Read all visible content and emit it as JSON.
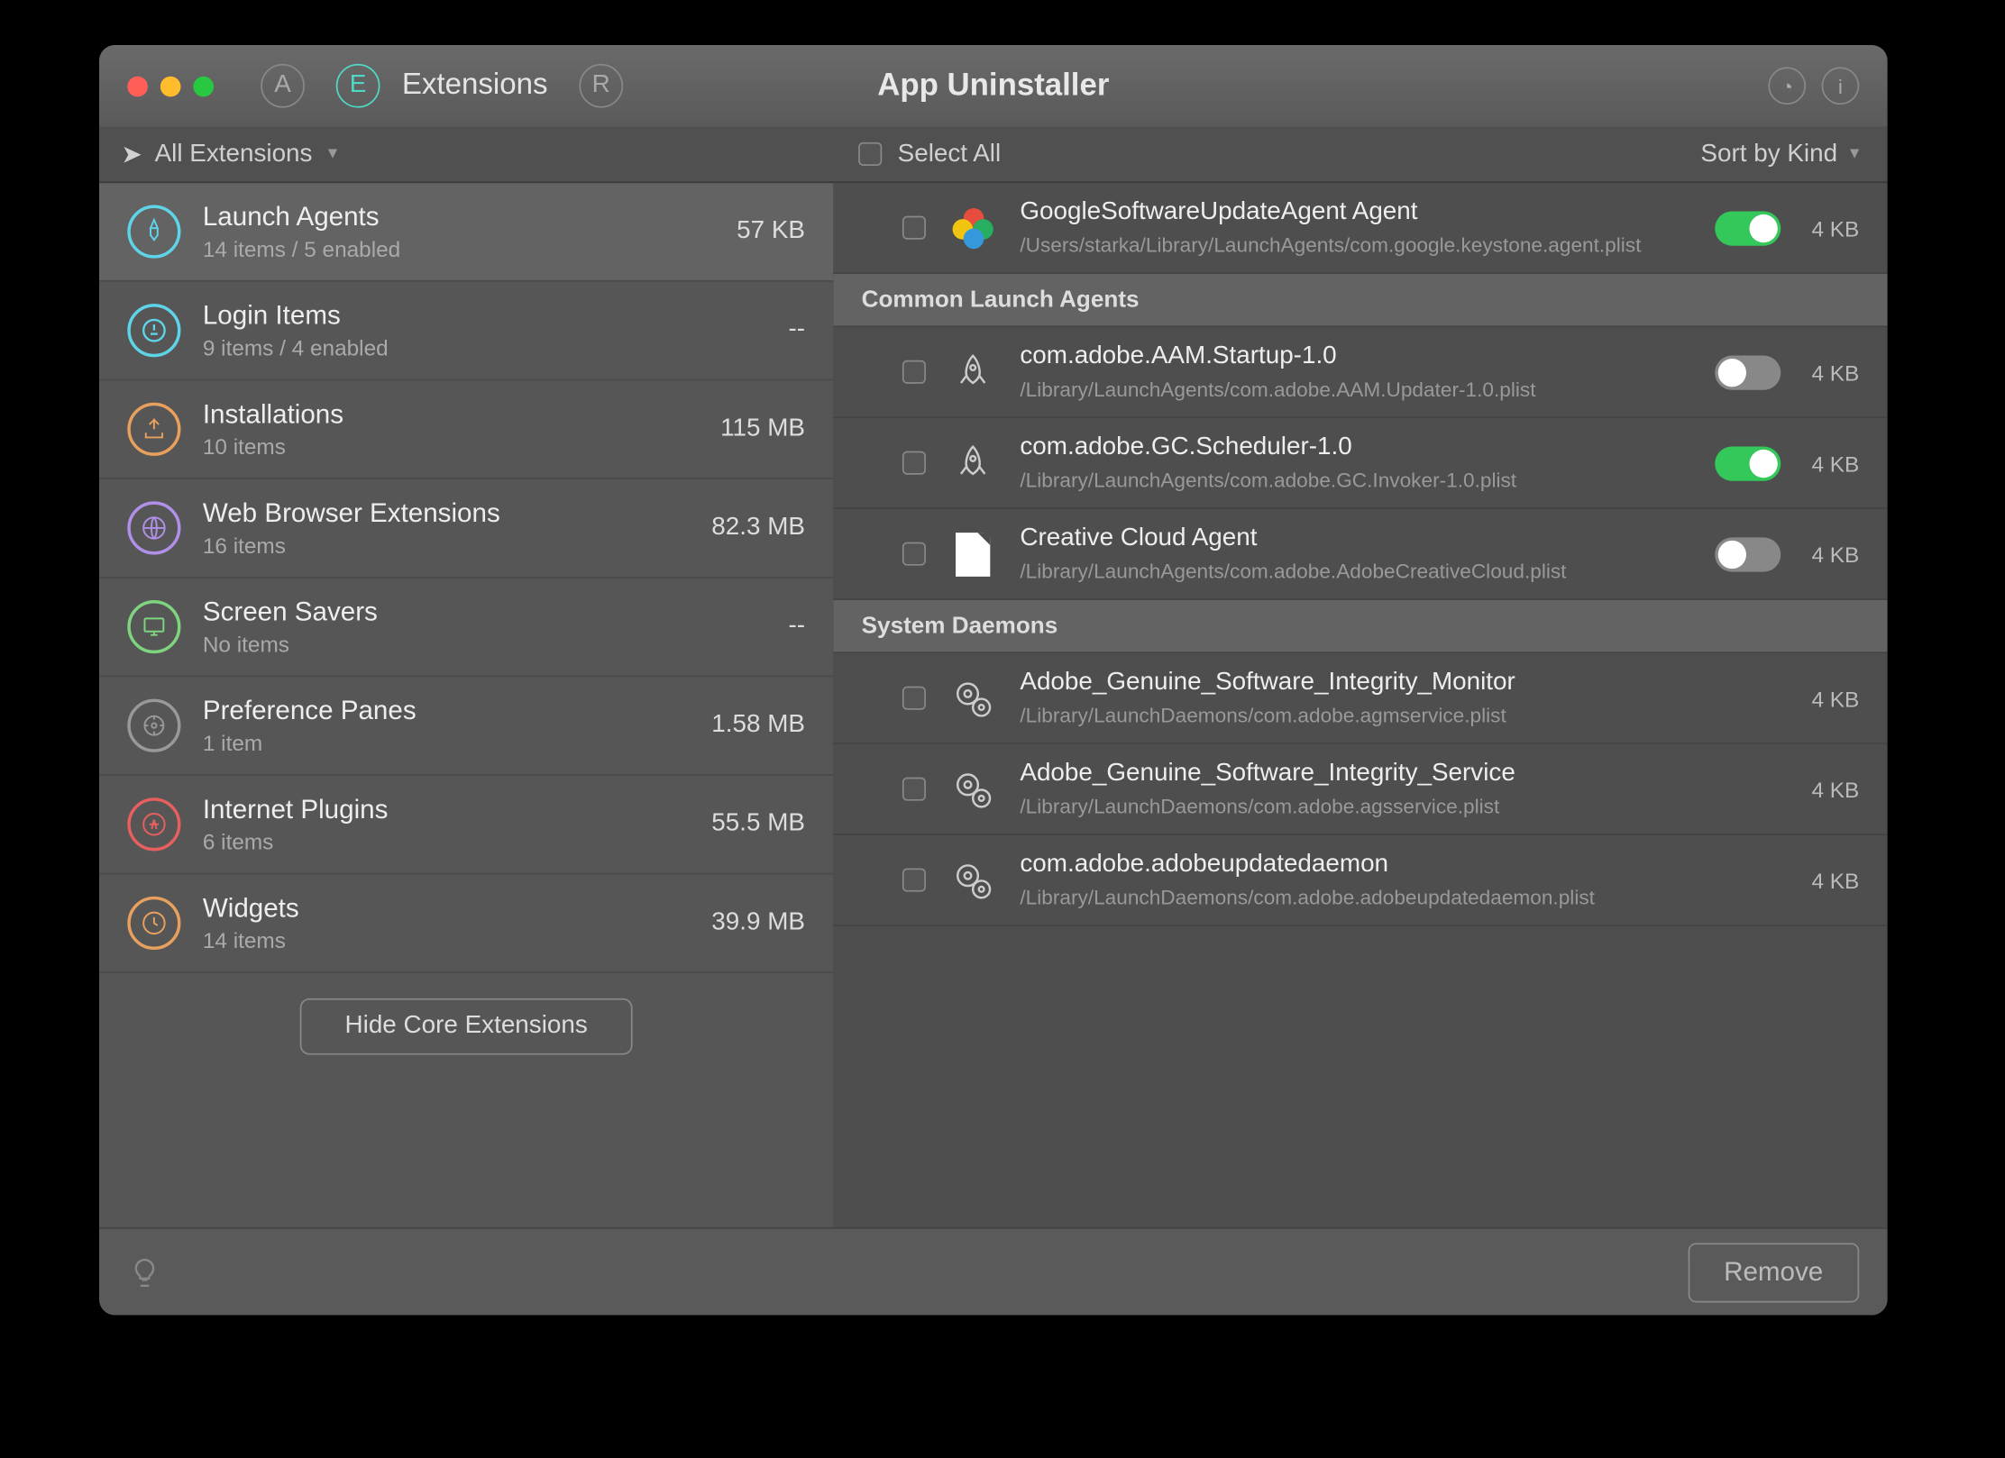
{
  "header": {
    "apptitle": "App Uninstaller",
    "tabname": "Extensions"
  },
  "toolbar": {
    "filter": "All Extensions",
    "selectall": "Select All",
    "sortby": "Sort by Kind"
  },
  "sidebar": {
    "items": [
      {
        "title": "Launch Agents",
        "sub": "14 items / 5 enabled",
        "size": "57 KB",
        "color": "#5fd4e8"
      },
      {
        "title": "Login Items",
        "sub": "9 items / 4 enabled",
        "size": "--",
        "color": "#5fd4e8"
      },
      {
        "title": "Installations",
        "sub": "10 items",
        "size": "115 MB",
        "color": "#e8a05f"
      },
      {
        "title": "Web Browser Extensions",
        "sub": "16 items",
        "size": "82.3 MB",
        "color": "#b090e8"
      },
      {
        "title": "Screen Savers",
        "sub": "No items",
        "size": "--",
        "color": "#7fd47f"
      },
      {
        "title": "Preference Panes",
        "sub": "1 item",
        "size": "1.58 MB",
        "color": "#999"
      },
      {
        "title": "Internet Plugins",
        "sub": "6 items",
        "size": "55.5 MB",
        "color": "#e85f5f"
      },
      {
        "title": "Widgets",
        "sub": "14 items",
        "size": "39.9 MB",
        "color": "#e8a05f"
      }
    ],
    "hidebtn": "Hide Core Extensions"
  },
  "main": {
    "top": {
      "title": "GoogleSoftwareUpdateAgent Agent",
      "path": "/Users/starka/Library/LaunchAgents/com.google.keystone.agent.plist",
      "size": "4 KB",
      "toggle": true
    },
    "groups": [
      {
        "head": "Common Launch Agents",
        "items": [
          {
            "title": "com.adobe.AAM.Startup-1.0",
            "path": "/Library/LaunchAgents/com.adobe.AAM.Updater-1.0.plist",
            "size": "4 KB",
            "toggle": false,
            "icon": "rocket"
          },
          {
            "title": "com.adobe.GC.Scheduler-1.0",
            "path": "/Library/LaunchAgents/com.adobe.GC.Invoker-1.0.plist",
            "size": "4 KB",
            "toggle": true,
            "icon": "rocket"
          },
          {
            "title": "Creative Cloud Agent",
            "path": "/Library/LaunchAgents/com.adobe.AdobeCreativeCloud.plist",
            "size": "4 KB",
            "toggle": false,
            "icon": "doc"
          }
        ]
      },
      {
        "head": "System Daemons",
        "items": [
          {
            "title": "Adobe_Genuine_Software_Integrity_Monitor",
            "path": "/Library/LaunchDaemons/com.adobe.agmservice.plist",
            "size": "4 KB",
            "icon": "gear"
          },
          {
            "title": "Adobe_Genuine_Software_Integrity_Service",
            "path": "/Library/LaunchDaemons/com.adobe.agsservice.plist",
            "size": "4 KB",
            "icon": "gear"
          },
          {
            "title": "com.adobe.adobeupdatedaemon",
            "path": "/Library/LaunchDaemons/com.adobe.adobeupdatedaemon.plist",
            "size": "4 KB",
            "icon": "gear"
          }
        ]
      }
    ]
  },
  "footer": {
    "remove": "Remove"
  }
}
